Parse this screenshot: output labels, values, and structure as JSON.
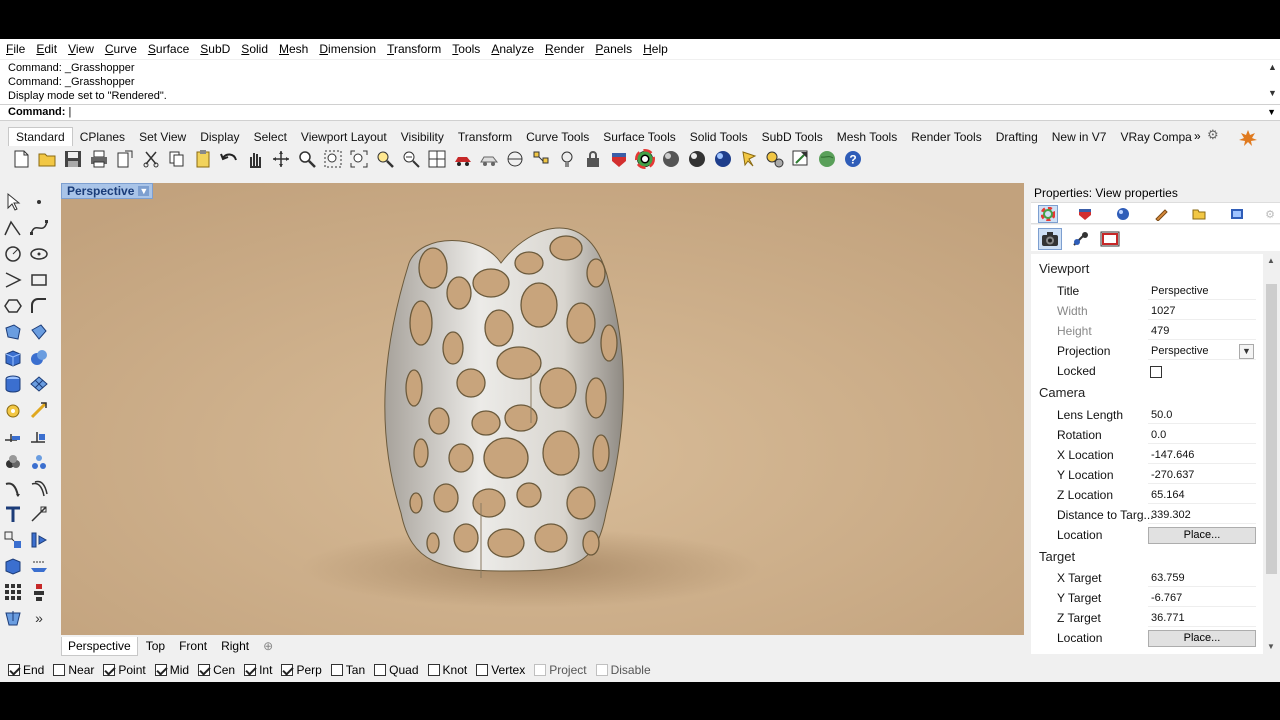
{
  "menu": [
    "File",
    "Edit",
    "View",
    "Curve",
    "Surface",
    "SubD",
    "Solid",
    "Mesh",
    "Dimension",
    "Transform",
    "Tools",
    "Analyze",
    "Render",
    "Panels",
    "Help"
  ],
  "command_history": [
    "Command: _Grasshopper",
    "Command: _Grasshopper",
    "Display mode set to \"Rendered\"."
  ],
  "command_prompt": "Command:",
  "toolbar_tabs": [
    "Standard",
    "CPlanes",
    "Set View",
    "Display",
    "Select",
    "Viewport Layout",
    "Visibility",
    "Transform",
    "Curve Tools",
    "Surface Tools",
    "Solid Tools",
    "SubD Tools",
    "Mesh Tools",
    "Render Tools",
    "Drafting",
    "New in V7",
    "VRay Compa"
  ],
  "tab_overflow": "»",
  "viewport": {
    "title": "Perspective",
    "bg_color": "#c9ab88"
  },
  "viewport_tabs": [
    "Perspective",
    "Top",
    "Front",
    "Right"
  ],
  "viewport_tab_add": "⊕",
  "osnaps": [
    {
      "label": "End",
      "checked": true
    },
    {
      "label": "Near",
      "checked": false
    },
    {
      "label": "Point",
      "checked": true
    },
    {
      "label": "Mid",
      "checked": true
    },
    {
      "label": "Cen",
      "checked": true
    },
    {
      "label": "Int",
      "checked": true
    },
    {
      "label": "Perp",
      "checked": true
    },
    {
      "label": "Tan",
      "checked": false
    },
    {
      "label": "Quad",
      "checked": false
    },
    {
      "label": "Knot",
      "checked": false
    },
    {
      "label": "Vertex",
      "checked": false
    },
    {
      "label": "Project",
      "checked": false
    },
    {
      "label": "Disable",
      "checked": false
    }
  ],
  "properties": {
    "panel_title": "Properties: View properties",
    "sections": {
      "viewport": "Viewport",
      "camera": "Camera",
      "target": "Target"
    },
    "viewport_rows": [
      {
        "label": "Title",
        "value": "Perspective"
      },
      {
        "label": "Width",
        "value": "1027"
      },
      {
        "label": "Height",
        "value": "479"
      },
      {
        "label": "Projection",
        "value": "Perspective"
      },
      {
        "label": "Locked",
        "value": ""
      }
    ],
    "camera_rows": [
      {
        "label": "Lens Length",
        "value": "50.0"
      },
      {
        "label": "Rotation",
        "value": "0.0"
      },
      {
        "label": "X Location",
        "value": "-147.646"
      },
      {
        "label": "Y Location",
        "value": "-270.637"
      },
      {
        "label": "Z Location",
        "value": "65.164"
      },
      {
        "label": "Distance to Targ...",
        "value": "339.302"
      },
      {
        "label": "Location",
        "value": "Place..."
      }
    ],
    "target_rows": [
      {
        "label": "X Target",
        "value": "63.759"
      },
      {
        "label": "Y Target",
        "value": "-6.767"
      },
      {
        "label": "Z Target",
        "value": "36.771"
      },
      {
        "label": "Location",
        "value": "Place..."
      }
    ]
  }
}
